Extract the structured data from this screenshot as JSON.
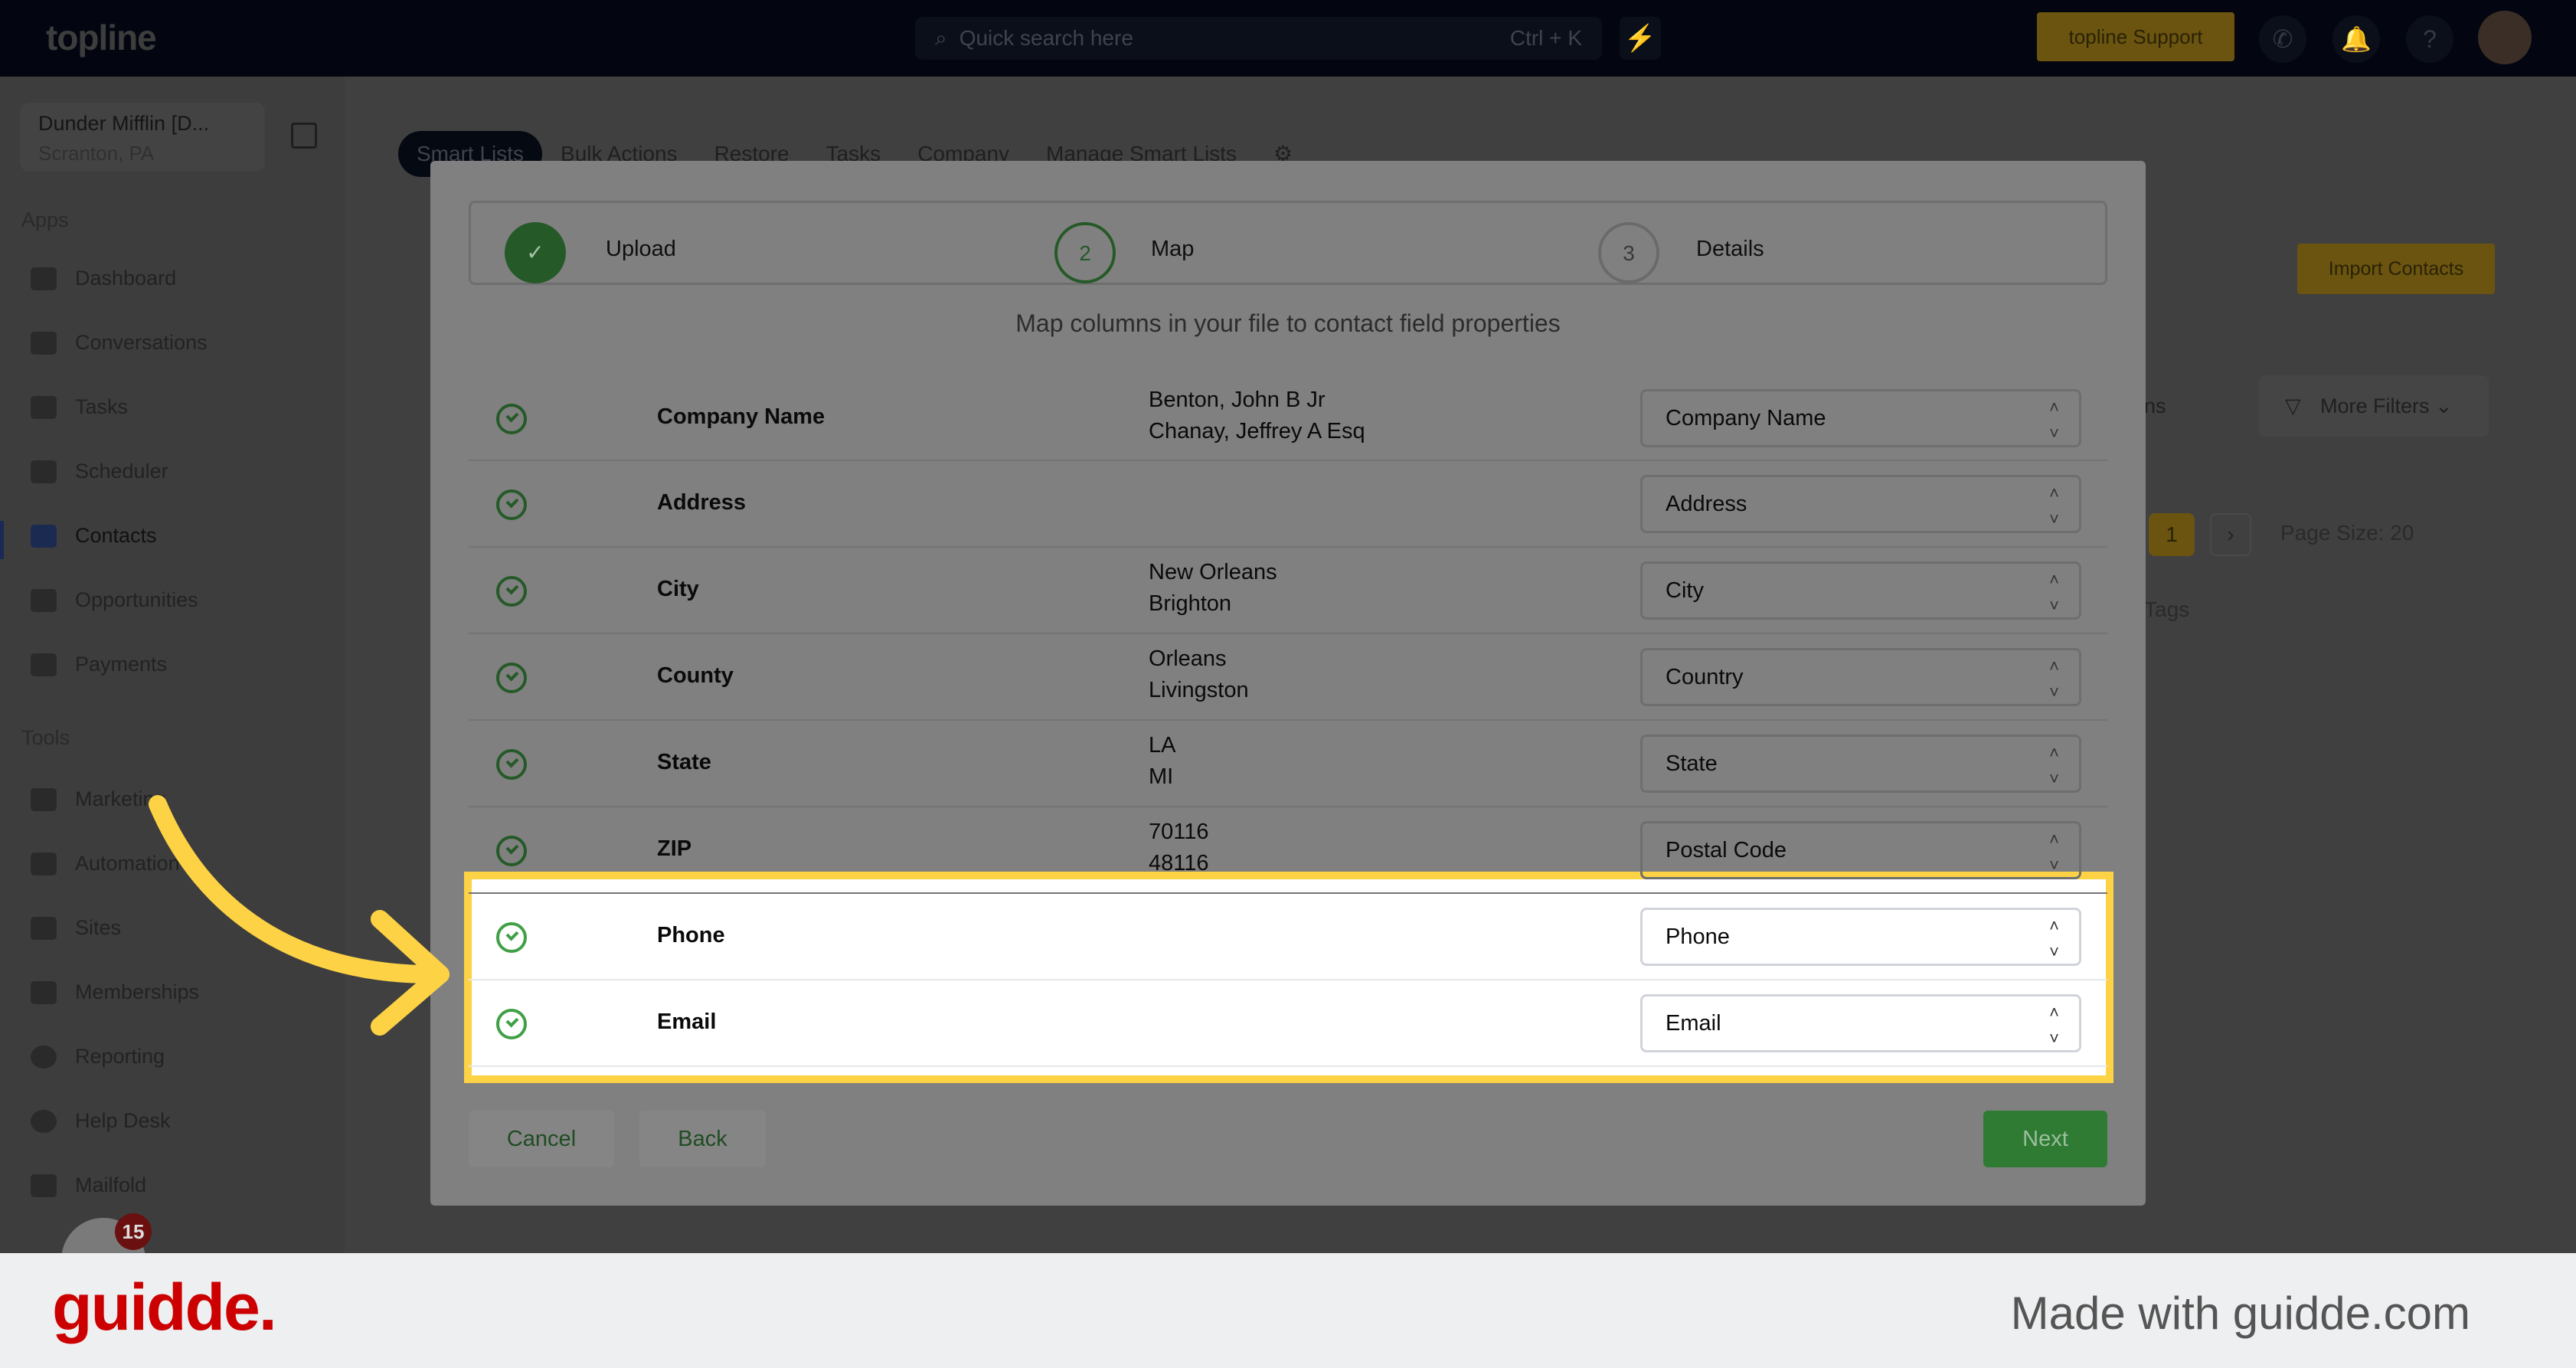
{
  "topbar": {
    "logo": "topline",
    "search_placeholder": "Quick search here",
    "search_shortcut": "Ctrl + K",
    "support_label": "topline Support",
    "icons": [
      "search-icon",
      "bolt-icon",
      "phone-icon",
      "bell-icon",
      "help-icon",
      "avatar"
    ]
  },
  "sidebar": {
    "account_name": "Dunder Mifflin [D...",
    "account_location": "Scranton, PA",
    "apps_heading": "Apps",
    "apps": [
      {
        "label": "Dashboard"
      },
      {
        "label": "Conversations"
      },
      {
        "label": "Tasks"
      },
      {
        "label": "Scheduler"
      },
      {
        "label": "Contacts"
      },
      {
        "label": "Opportunities"
      },
      {
        "label": "Payments"
      }
    ],
    "tools_heading": "Tools",
    "tools": [
      {
        "label": "Marketing"
      },
      {
        "label": "Automation"
      },
      {
        "label": "Sites"
      },
      {
        "label": "Memberships"
      },
      {
        "label": "Reporting"
      },
      {
        "label": "Help Desk"
      },
      {
        "label": "Mailfold"
      }
    ],
    "active": "Contacts",
    "chat_badge": "15"
  },
  "main": {
    "tabs": [
      "Smart Lists",
      "Bulk Actions",
      "Restore",
      "Tasks",
      "Company",
      "Manage Smart Lists"
    ],
    "import_label": "Import Contacts",
    "columns_partial": "ns",
    "more_filters": "More Filters",
    "page": "1",
    "page_size": "Page Size: 20",
    "tags_header": "Tags"
  },
  "modal": {
    "steps": [
      {
        "num": "✓",
        "label": "Upload",
        "state": "done"
      },
      {
        "num": "2",
        "label": "Map",
        "state": "active"
      },
      {
        "num": "3",
        "label": "Details",
        "state": "pending"
      }
    ],
    "subtitle": "Map columns in your file to contact field properties",
    "rows": [
      {
        "column": "Company Name",
        "sample": "Benton, John B Jr\nChanay, Jeffrey A Esq",
        "field": "Company Name"
      },
      {
        "column": "Address",
        "sample": "",
        "field": "Address"
      },
      {
        "column": "City",
        "sample": "New Orleans\nBrighton",
        "field": "City"
      },
      {
        "column": "County",
        "sample": "Orleans\nLivingston",
        "field": "Country"
      },
      {
        "column": "State",
        "sample": "LA\nMI",
        "field": "State"
      },
      {
        "column": "ZIP",
        "sample": "70116\n48116",
        "field": "Postal Code"
      },
      {
        "column": "Phone",
        "sample": "",
        "field": "Phone"
      },
      {
        "column": "Email",
        "sample": "",
        "field": "Email"
      }
    ],
    "cancel_label": "Cancel",
    "back_label": "Back",
    "next_label": "Next"
  },
  "colors": {
    "highlight": "#fdd244",
    "accent_green": "#2f7b33",
    "guidde_red": "#cc0000"
  },
  "footer": {
    "logo": "guidde.",
    "made_with": "Made with guidde.com"
  }
}
